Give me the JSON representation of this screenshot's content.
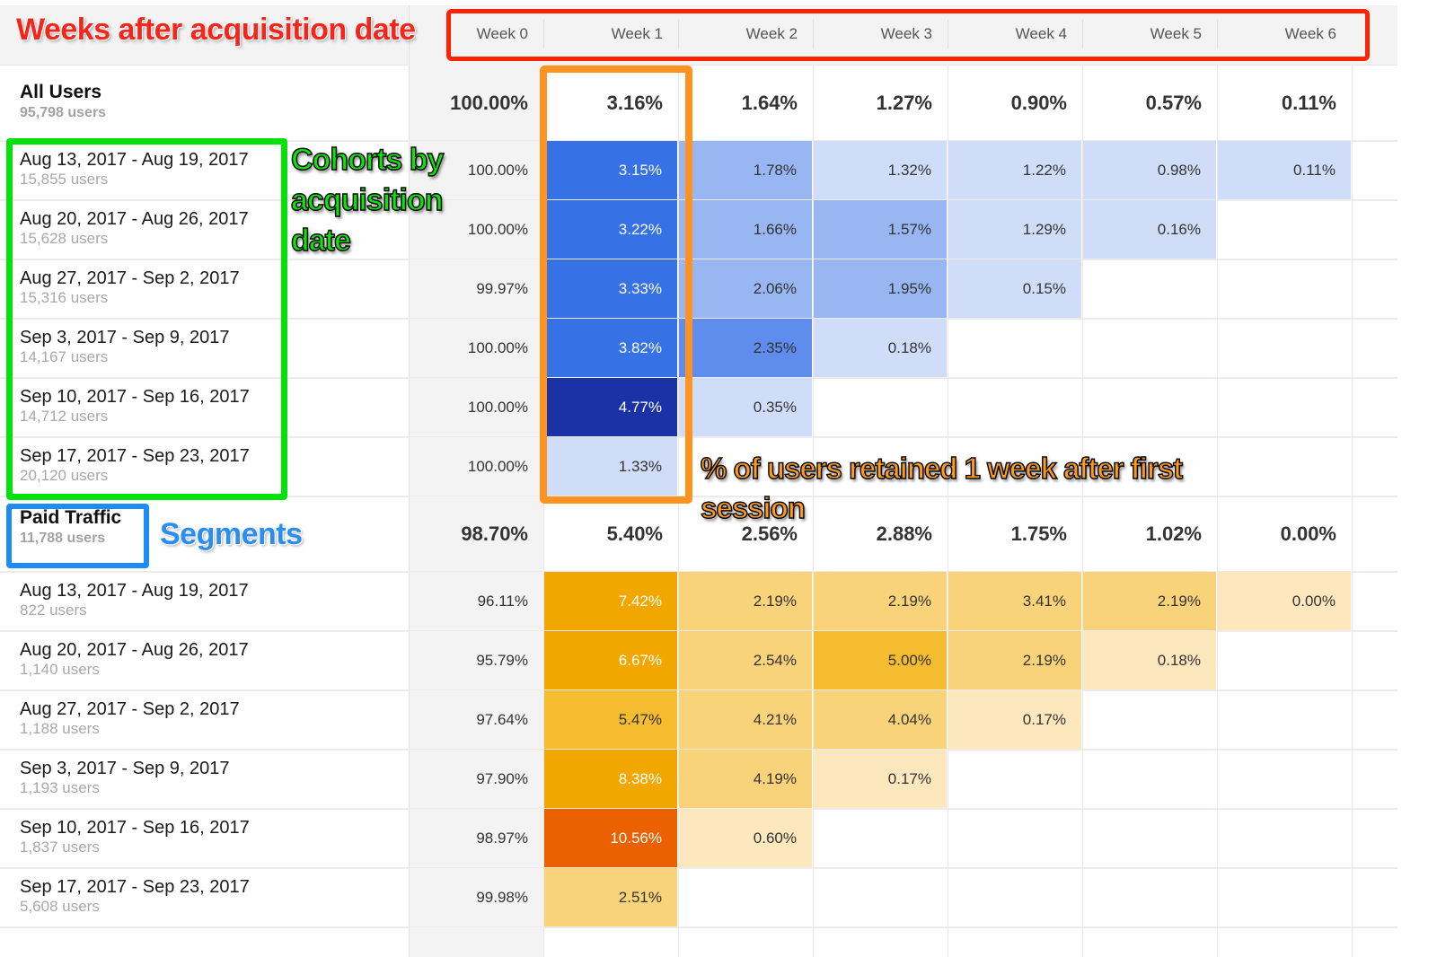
{
  "header": {
    "annotation": "Weeks after acquisition date",
    "weeks": [
      "Week 0",
      "Week 1",
      "Week 2",
      "Week 3",
      "Week 4",
      "Week 5",
      "Week 6"
    ]
  },
  "annotations": {
    "cohorts": "Cohorts by acquisition date",
    "retained": "% of users retained 1 week after first session",
    "segments": "Segments"
  },
  "colors": {
    "annotation_red": "#f2261a",
    "annotation_green": "#04e10b",
    "annotation_orange": "#ff9320",
    "annotation_blue": "#1e8cf5",
    "blue_scale": [
      "#d0ddf9",
      "#98b6f2",
      "#5f8ded",
      "#3672e6",
      "#1a32a6"
    ],
    "orange_scale": [
      "#fde7bd",
      "#f9d37a",
      "#f5bc30",
      "#f1a700",
      "#eb6100"
    ]
  },
  "segments": [
    {
      "name": "All Users",
      "users": "95,798 users",
      "theme": "blue",
      "totals": [
        "100.00%",
        "3.16%",
        "1.64%",
        "1.27%",
        "0.90%",
        "0.57%",
        "0.11%"
      ],
      "cohorts": [
        {
          "date": "Aug 13, 2017 - Aug 19, 2017",
          "users": "15,855 users",
          "values": [
            "100.00%",
            "3.15%",
            "1.78%",
            "1.32%",
            "1.22%",
            "0.98%",
            "0.11%"
          ],
          "levels": [
            null,
            3,
            1,
            0,
            0,
            0,
            0
          ]
        },
        {
          "date": "Aug 20, 2017 - Aug 26, 2017",
          "users": "15,628 users",
          "values": [
            "100.00%",
            "3.22%",
            "1.66%",
            "1.57%",
            "1.29%",
            "0.16%"
          ],
          "levels": [
            null,
            3,
            1,
            1,
            0,
            0
          ]
        },
        {
          "date": "Aug 27, 2017 - Sep 2, 2017",
          "users": "15,316 users",
          "values": [
            "99.97%",
            "3.33%",
            "2.06%",
            "1.95%",
            "0.15%"
          ],
          "levels": [
            null,
            3,
            1,
            1,
            0
          ]
        },
        {
          "date": "Sep 3, 2017 - Sep 9, 2017",
          "users": "14,167 users",
          "values": [
            "100.00%",
            "3.82%",
            "2.35%",
            "0.18%"
          ],
          "levels": [
            null,
            3,
            2,
            0
          ]
        },
        {
          "date": "Sep 10, 2017 - Sep 16, 2017",
          "users": "14,712 users",
          "values": [
            "100.00%",
            "4.77%",
            "0.35%"
          ],
          "levels": [
            null,
            4,
            0
          ]
        },
        {
          "date": "Sep 17, 2017 - Sep 23, 2017",
          "users": "20,120 users",
          "values": [
            "100.00%",
            "1.33%"
          ],
          "levels": [
            null,
            0
          ]
        }
      ]
    },
    {
      "name": "Paid Traffic",
      "users": "11,788 users",
      "theme": "orange",
      "totals": [
        "98.70%",
        "5.40%",
        "2.56%",
        "2.88%",
        "1.75%",
        "1.02%",
        "0.00%"
      ],
      "cohorts": [
        {
          "date": "Aug 13, 2017 - Aug 19, 2017",
          "users": "822 users",
          "values": [
            "96.11%",
            "7.42%",
            "2.19%",
            "2.19%",
            "3.41%",
            "2.19%",
            "0.00%"
          ],
          "levels": [
            null,
            3,
            1,
            1,
            1,
            1,
            0
          ]
        },
        {
          "date": "Aug 20, 2017 - Aug 26, 2017",
          "users": "1,140 users",
          "values": [
            "95.79%",
            "6.67%",
            "2.54%",
            "5.00%",
            "2.19%",
            "0.18%"
          ],
          "levels": [
            null,
            3,
            1,
            2,
            1,
            0
          ]
        },
        {
          "date": "Aug 27, 2017 - Sep 2, 2017",
          "users": "1,188 users",
          "values": [
            "97.64%",
            "5.47%",
            "4.21%",
            "4.04%",
            "0.17%"
          ],
          "levels": [
            null,
            2,
            1,
            1,
            0
          ]
        },
        {
          "date": "Sep 3, 2017 - Sep 9, 2017",
          "users": "1,193 users",
          "values": [
            "97.90%",
            "8.38%",
            "4.19%",
            "0.17%"
          ],
          "levels": [
            null,
            3,
            1,
            0
          ]
        },
        {
          "date": "Sep 10, 2017 - Sep 16, 2017",
          "users": "1,837 users",
          "values": [
            "98.97%",
            "10.56%",
            "0.60%"
          ],
          "levels": [
            null,
            4,
            0
          ]
        },
        {
          "date": "Sep 17, 2017 - Sep 23, 2017",
          "users": "5,608 users",
          "values": [
            "99.98%",
            "2.51%"
          ],
          "levels": [
            null,
            1
          ]
        }
      ]
    }
  ]
}
